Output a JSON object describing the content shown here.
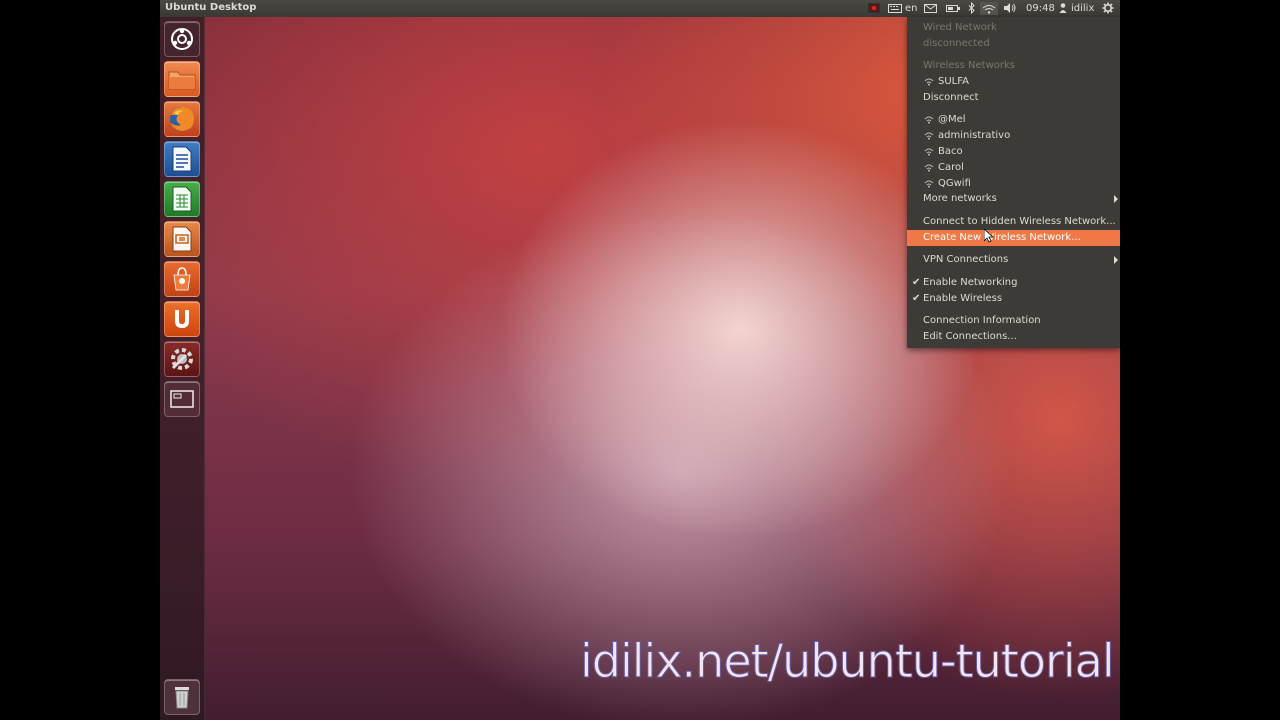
{
  "panel": {
    "title": "Ubuntu Desktop",
    "keyboard_layout": "en",
    "clock": "09:48",
    "user": "idilix"
  },
  "launcher": {
    "items": [
      {
        "icon": "dash-home-icon"
      },
      {
        "icon": "home-folder-icon"
      },
      {
        "icon": "firefox-icon"
      },
      {
        "icon": "libreoffice-writer-icon"
      },
      {
        "icon": "libreoffice-calc-icon"
      },
      {
        "icon": "libreoffice-impress-icon"
      },
      {
        "icon": "ubuntu-software-center-icon"
      },
      {
        "icon": "ubuntu-one-icon"
      },
      {
        "icon": "system-settings-icon"
      },
      {
        "icon": "workspace-switcher-icon"
      }
    ],
    "trash": {
      "icon": "trash-icon"
    }
  },
  "network_menu": {
    "wired_header": "Wired Network",
    "wired_status": "disconnected",
    "wireless_header": "Wireless Networks",
    "connected_network": "SULFA",
    "disconnect": "Disconnect",
    "networks": [
      "@Mel",
      "administrativo",
      "Baco",
      "Carol",
      "QGwifi"
    ],
    "more_networks": "More networks",
    "connect_hidden": "Connect to Hidden Wireless Network...",
    "create_new": "Create New Wireless Network...",
    "vpn": "VPN Connections",
    "enable_networking": "Enable Networking",
    "enable_wireless": "Enable Wireless",
    "connection_info": "Connection Information",
    "edit_connections": "Edit Connections..."
  },
  "watermark": "idilix.net/ubuntu-tutorial",
  "colors": {
    "highlight": "#f07746",
    "menu_bg": "#3c3b37",
    "panel_bg": "#3c3b37"
  }
}
